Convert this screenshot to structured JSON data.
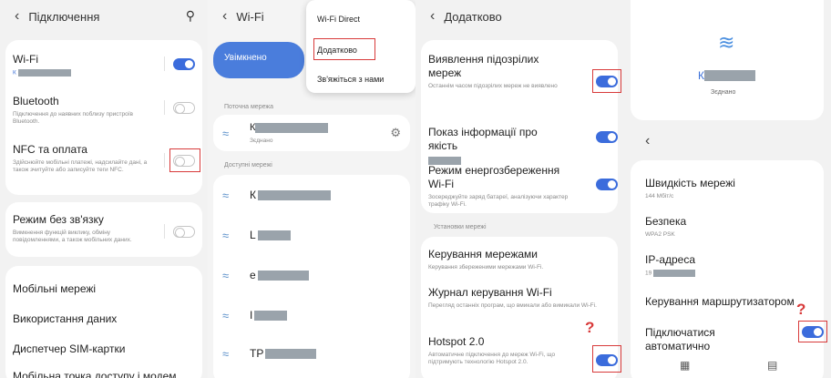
{
  "panel1": {
    "header": {
      "title": "Підключення"
    },
    "items": [
      {
        "title": "Wi-Fi",
        "sub": "К",
        "toggle": "on"
      },
      {
        "title": "Bluetooth",
        "sub": "Підключення до наявних поблизу пристроїв Bluetooth.",
        "toggle": "off"
      },
      {
        "title": "NFC та оплата",
        "sub": "Здійснюйте мобільні платежі, надсилайте дані, а також зчитуйте або записуйте теги NFC.",
        "toggle": "off"
      },
      {
        "title": "Режим без зв'язку",
        "sub": "Вимкнення функцій виклику, обміну повідомленнями, а також мобільних даних.",
        "toggle": "off"
      },
      {
        "title": "Мобільні мережі"
      },
      {
        "title": "Використання даних"
      },
      {
        "title": "Диспетчер SIM-картки"
      },
      {
        "title": "Мобільна точка доступу і модем"
      }
    ]
  },
  "panel2": {
    "header": {
      "title": "Wi-Fi"
    },
    "enabled_label": "Увімкнено",
    "menu": [
      "Wi-Fi Direct",
      "Додатково",
      "Зв'яжіться з нами"
    ],
    "current_label": "Поточна мережа",
    "current_network": {
      "name": "К",
      "status": "Зєднано"
    },
    "available_label": "Доступні мережі",
    "networks": [
      "К",
      "L",
      "e",
      "I",
      "TP"
    ]
  },
  "panel3": {
    "header": {
      "title": "Додатково"
    },
    "items": [
      {
        "title": "Виявлення підозрілих мереж",
        "sub": "Останнім часом підозрілих мереж не виявлено",
        "toggle": "on"
      },
      {
        "title": "Показ інформації про якість",
        "toggle": "on"
      },
      {
        "title": "Режим енергозбереження Wi-Fi",
        "sub": "Зосереджуйте заряд батареї, аналізуючи характер трафіку Wi-Fi.",
        "toggle": "on"
      }
    ],
    "section_label": "Установки мережі",
    "items2": [
      {
        "title": "Керування мережами",
        "sub": "Керування збереженими мережами Wi-Fi."
      },
      {
        "title": "Журнал керування Wi-Fi",
        "sub": "Перегляд останніх програм, що вмикали або вимикали Wi-Fi."
      },
      {
        "title": "Hotspot 2.0",
        "sub": "Автоматичне підключення до мереж Wi-Fi, що підтримують технологію Hotspot 2.0.",
        "toggle": "on"
      }
    ],
    "question": "?"
  },
  "panel4": {
    "network_name": "К",
    "status": "Зєднано",
    "items": [
      {
        "title": "Швидкість мережі",
        "sub": "144 Мбіт/с"
      },
      {
        "title": "Безпека",
        "sub": "WPA2 PSK"
      },
      {
        "title": "IP-адреса",
        "sub": "19"
      },
      {
        "title": "Керування маршрутизатором"
      },
      {
        "title": "Підключатися автоматично",
        "toggle": "on"
      }
    ],
    "question": "?"
  },
  "colors": {
    "accent": "#3b6cdc",
    "highlight": "#d83a3a"
  }
}
